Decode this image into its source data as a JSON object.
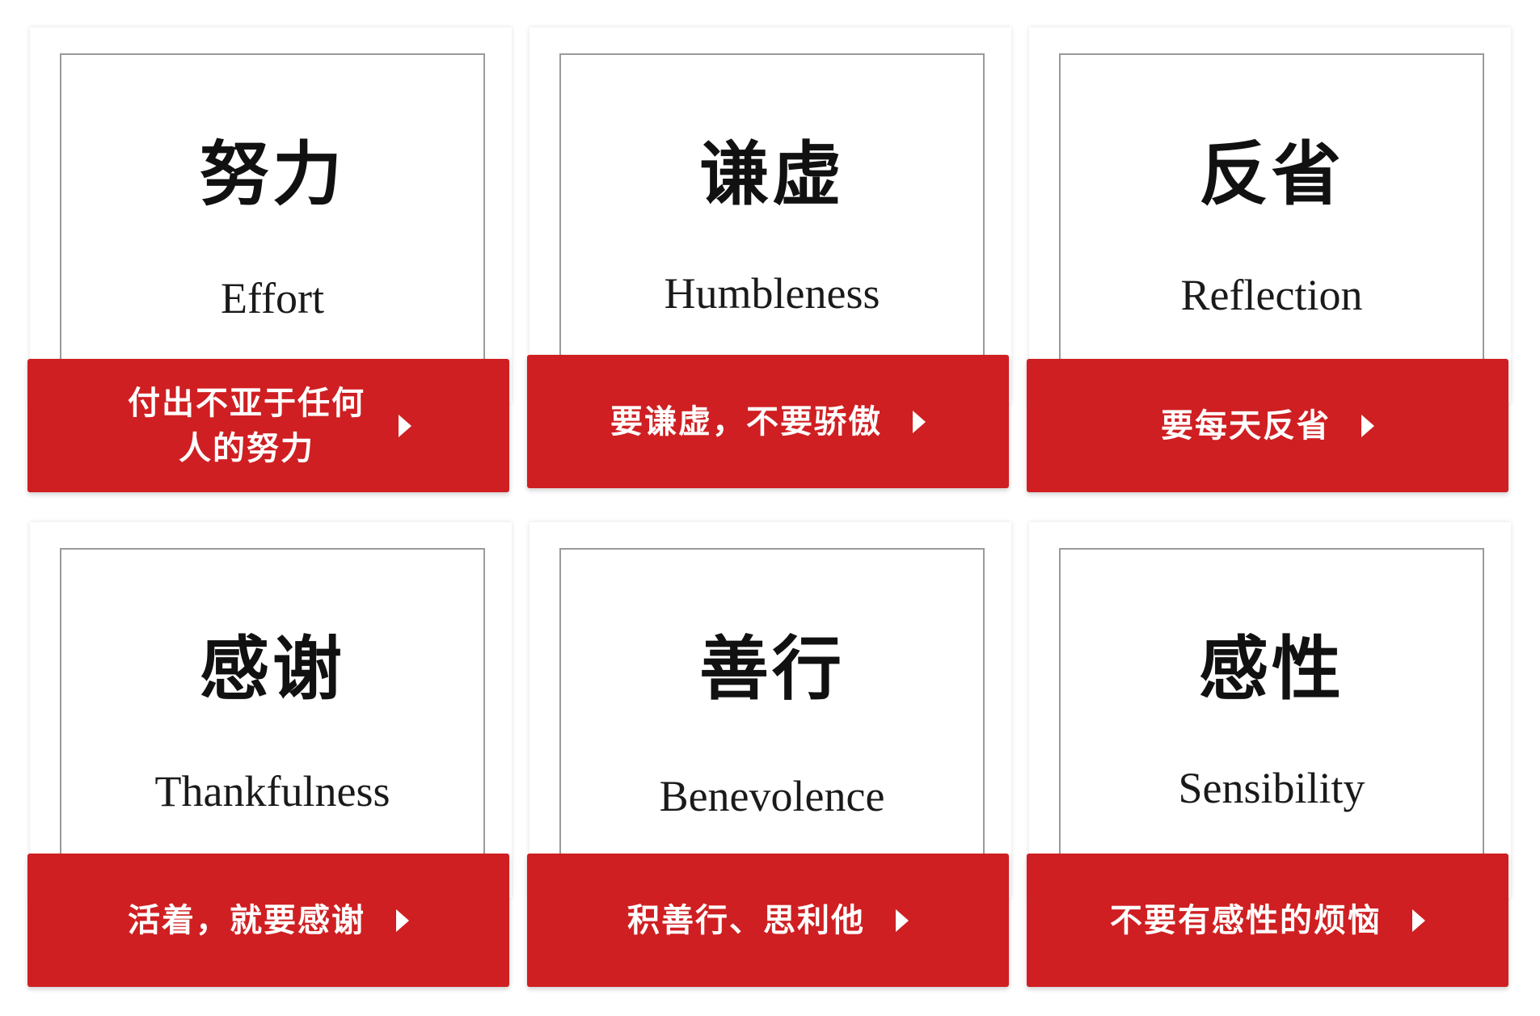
{
  "cards": [
    {
      "title_zh": "努力",
      "title_en": "Effort",
      "button_label": "付出不亚于任何人的努力",
      "button_arrow": "chevron-right-icon"
    },
    {
      "title_zh": "谦虚",
      "title_en": "Humbleness",
      "button_label": "要谦虚，不要骄傲",
      "button_arrow": "chevron-right-icon"
    },
    {
      "title_zh": "反省",
      "title_en": "Reflection",
      "button_label": "要每天反省",
      "button_arrow": "chevron-right-icon"
    },
    {
      "title_zh": "感谢",
      "title_en": "Thankfulness",
      "button_label": "活着，就要感谢",
      "button_arrow": "chevron-right-icon"
    },
    {
      "title_zh": "善行",
      "title_en": "Benevolence",
      "button_label": "积善行、思利他",
      "button_arrow": "chevron-right-icon"
    },
    {
      "title_zh": "感性",
      "title_en": "Sensibility",
      "button_label": "不要有感性的烦恼",
      "button_arrow": "chevron-right-icon"
    }
  ],
  "colors": {
    "accent": "#cf1f22",
    "background": "#ffffff",
    "frame_border": "#9a9a9a"
  }
}
